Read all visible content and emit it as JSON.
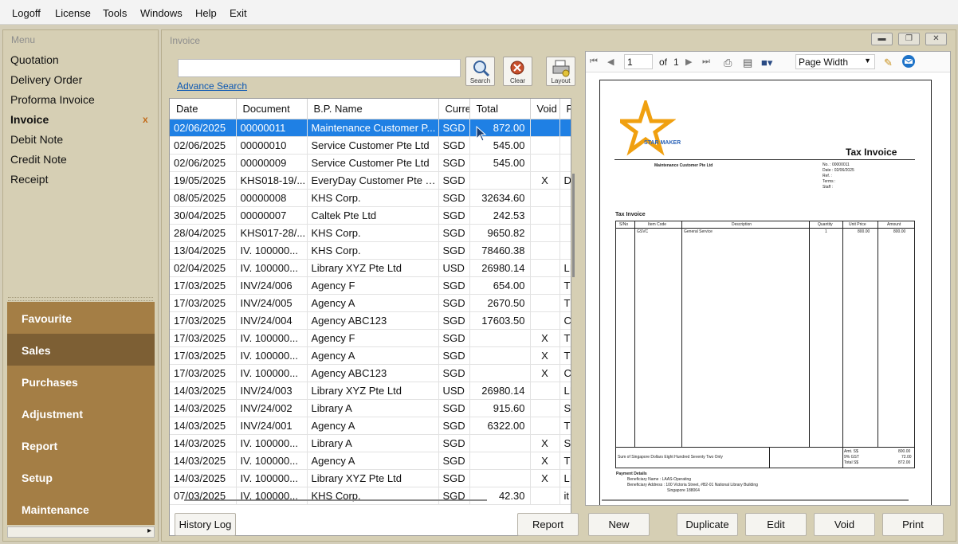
{
  "menubar": [
    "Logoff",
    "License",
    "Tools",
    "Windows",
    "Help",
    "Exit"
  ],
  "left": {
    "title": "Menu",
    "items": [
      "Quotation",
      "Delivery Order",
      "Proforma Invoice",
      "Invoice",
      "Debit Note",
      "Credit Note",
      "Receipt"
    ],
    "active_item": "Invoice",
    "close_mark": "x",
    "nav": [
      "Favourite",
      "Sales",
      "Purchases",
      "Adjustment",
      "Report",
      "Setup",
      "Maintenance"
    ],
    "selected_nav": "Sales"
  },
  "window": {
    "title": "Invoice",
    "advanced_search": "Advance Search",
    "search_value": "",
    "tool_buttons": {
      "search": "Search",
      "clear": "Clear",
      "layout": "Layout"
    }
  },
  "grid": {
    "columns": [
      "Date",
      "Document",
      "B.P. Name",
      "Curre",
      "Total",
      "Void",
      "F"
    ],
    "rows": [
      [
        "02/06/2025",
        "00000011",
        "Maintenance Customer P...",
        "SGD",
        "872.00",
        "",
        ""
      ],
      [
        "02/06/2025",
        "00000010",
        "Service Customer Pte Ltd",
        "SGD",
        "545.00",
        "",
        ""
      ],
      [
        "02/06/2025",
        "00000009",
        "Service Customer Pte Ltd",
        "SGD",
        "545.00",
        "",
        ""
      ],
      [
        "19/05/2025",
        "KHS018-19/...",
        "EveryDay Customer Pte Ltd",
        "SGD",
        "",
        "X",
        "D"
      ],
      [
        "08/05/2025",
        "00000008",
        "KHS Corp.",
        "SGD",
        "32634.60",
        "",
        ""
      ],
      [
        "30/04/2025",
        "00000007",
        "Caltek Pte Ltd",
        "SGD",
        "242.53",
        "",
        ""
      ],
      [
        "28/04/2025",
        "KHS017-28/...",
        "KHS Corp.",
        "SGD",
        "9650.82",
        "",
        ""
      ],
      [
        "13/04/2025",
        "IV. 100000...",
        "KHS Corp.",
        "SGD",
        "78460.38",
        "",
        ""
      ],
      [
        "02/04/2025",
        "IV. 100000...",
        "Library XYZ Pte Ltd",
        "USD",
        "26980.14",
        "",
        "LI"
      ],
      [
        "17/03/2025",
        "INV/24/006",
        "Agency F",
        "SGD",
        "654.00",
        "",
        "T"
      ],
      [
        "17/03/2025",
        "INV/24/005",
        "Agency A",
        "SGD",
        "2670.50",
        "",
        "T"
      ],
      [
        "17/03/2025",
        "INV/24/004",
        "Agency ABC123",
        "SGD",
        "17603.50",
        "",
        "C"
      ],
      [
        "17/03/2025",
        "IV. 100000...",
        "Agency F",
        "SGD",
        "",
        "X",
        "T"
      ],
      [
        "17/03/2025",
        "IV. 100000...",
        "Agency A",
        "SGD",
        "",
        "X",
        "T"
      ],
      [
        "17/03/2025",
        "IV. 100000...",
        "Agency ABC123",
        "SGD",
        "",
        "X",
        "C"
      ],
      [
        "14/03/2025",
        "INV/24/003",
        "Library XYZ Pte Ltd",
        "USD",
        "26980.14",
        "",
        "LI"
      ],
      [
        "14/03/2025",
        "INV/24/002",
        "Library A",
        "SGD",
        "915.60",
        "",
        "S"
      ],
      [
        "14/03/2025",
        "INV/24/001",
        "Agency A",
        "SGD",
        "6322.00",
        "",
        "T"
      ],
      [
        "14/03/2025",
        "IV. 100000...",
        "Library A",
        "SGD",
        "",
        "X",
        "S"
      ],
      [
        "14/03/2025",
        "IV. 100000...",
        "Agency A",
        "SGD",
        "",
        "X",
        "T"
      ],
      [
        "14/03/2025",
        "IV. 100000...",
        "Library XYZ Pte Ltd",
        "SGD",
        "",
        "X",
        "LI"
      ],
      [
        "07/03/2025",
        "IV. 100000...",
        "KHS Corp.",
        "SGD",
        "42.30",
        "",
        "it"
      ]
    ],
    "selected_row": 0
  },
  "preview": {
    "page": "1",
    "of_label": "of",
    "page_total": "1",
    "zoom": "Page Width",
    "logo_text": "STAR MAKER",
    "invoice": {
      "heading": "Tax Invoice",
      "customer": "Maintenance Customer Pte Ltd",
      "meta": [
        "No. : 00000011",
        "Date : 02/06/2025",
        "Ref. :",
        "Terms :",
        "Staff :"
      ],
      "section": "Tax Invoice",
      "cols": [
        "S/No",
        "Item Code",
        "Description",
        "Quantity",
        "Unit Price",
        "Amount"
      ],
      "line": [
        "",
        "GSVC",
        "General Service",
        "1",
        "800.00",
        "800.00"
      ],
      "words": "Sum of Singapore Dollars Eight Hundred Seventy Two Only",
      "totals": [
        "Amt. S$",
        "9% GST",
        "Total S$"
      ],
      "total_vals": [
        "800.00",
        "72.00",
        "872.00"
      ],
      "payment_title": "Payment Details",
      "payment": [
        "Beneficiary Name : LAAS-Operating",
        "Beneficiary Address : 100 Victoria Street, #B2-01 National Library Building",
        "Singapore 188064"
      ]
    }
  },
  "actions": [
    "History Log",
    "Report",
    "New",
    "Duplicate",
    "Edit",
    "Void",
    "Print"
  ]
}
